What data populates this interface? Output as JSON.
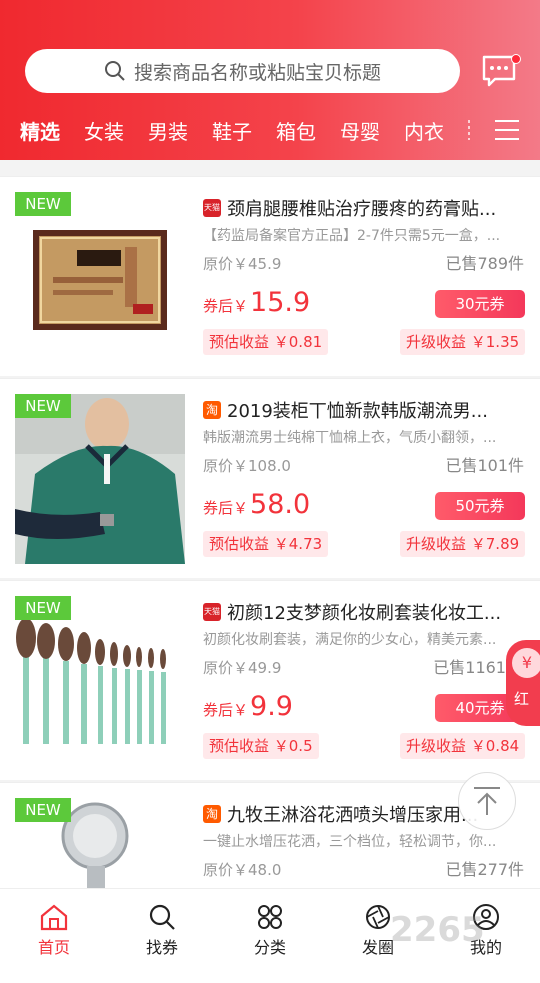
{
  "header": {
    "search_placeholder": "搜索商品名称或粘贴宝贝标题",
    "tabs": [
      "精选",
      "女装",
      "男装",
      "鞋子",
      "箱包",
      "母婴",
      "内衣"
    ]
  },
  "products": [
    {
      "tag": "NEW",
      "platform": "天猫",
      "title": "颈肩腿腰椎贴治疗腰疼的药膏贴...",
      "desc": "【药监局备案官方正品】2-7件只需5元一盒，...",
      "orig_price": "原价￥45.9",
      "sold": "已售789件",
      "after_label": "券后￥",
      "price": "15.9",
      "coupon": "30元券",
      "earn_est": "预估收益 ￥0.81",
      "earn_up": "升级收益 ￥1.35"
    },
    {
      "tag": "NEW",
      "platform": "淘",
      "title": "2019装柜丅恤新款韩版潮流男...",
      "desc": "韩版潮流男士纯棉丅恤棉上衣，气质小翻领，...",
      "orig_price": "原价￥108.0",
      "sold": "已售101件",
      "after_label": "券后￥",
      "price": "58.0",
      "coupon": "50元券",
      "earn_est": "预估收益 ￥4.73",
      "earn_up": "升级收益 ￥7.89"
    },
    {
      "tag": "NEW",
      "platform": "天猫",
      "title": "初颜12支梦颜化妆刷套装化妆工...",
      "desc": "初颜化妆刷套装，满足你的少女心，精美元素...",
      "orig_price": "原价￥49.9",
      "sold": "已售1161",
      "after_label": "券后￥",
      "price": "9.9",
      "coupon": "40元券",
      "earn_est": "预估收益 ￥0.5",
      "earn_up": "升级收益 ￥0.84"
    },
    {
      "tag": "NEW",
      "platform": "淘",
      "title": "九牧王淋浴花洒喷头增压家用...",
      "desc": "一键止水增压花洒，三个档位，轻松调节，你...",
      "orig_price": "原价￥48.0",
      "sold": "已售277件"
    }
  ],
  "float_label": "红",
  "bottom_nav": [
    "首页",
    "找券",
    "分类",
    "发圈",
    "我的"
  ],
  "watermark": "2265",
  "colors": {
    "brand_red": "#f2333b",
    "new_green": "#5cc93b"
  }
}
